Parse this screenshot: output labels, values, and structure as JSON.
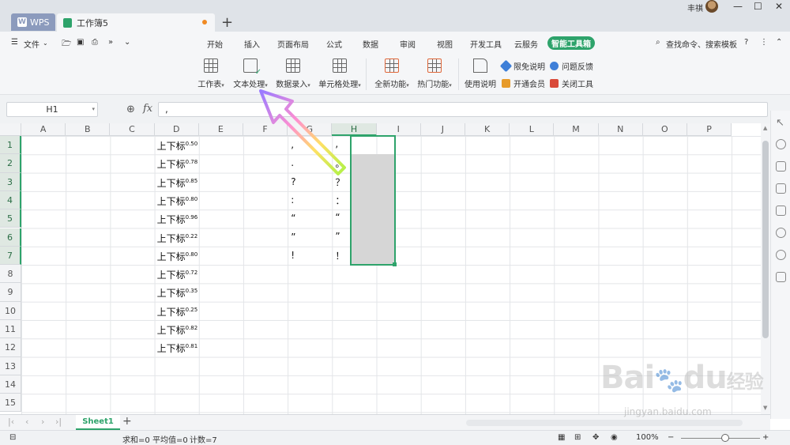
{
  "titlebar": {
    "tabs": [
      {
        "label": "WPS"
      },
      {
        "label": "工作簿5"
      }
    ],
    "user_name": "丰祺"
  },
  "menubar": {
    "file": "文件",
    "items": [
      "开始",
      "插入",
      "页面布局",
      "公式",
      "数据",
      "审阅",
      "视图",
      "开发工具",
      "云服务"
    ],
    "active": "智能工具箱",
    "search": "查找命令、搜索模板"
  },
  "ribbon": {
    "groups": [
      {
        "label": "工作表"
      },
      {
        "label": "文本处理"
      },
      {
        "label": "数据录入"
      },
      {
        "label": "单元格处理"
      },
      {
        "label": "全新功能"
      },
      {
        "label": "热门功能"
      },
      {
        "label": "使用说明"
      }
    ],
    "side": [
      {
        "label": "限免说明"
      },
      {
        "label": "问题反馈"
      },
      {
        "label": "开通会员"
      },
      {
        "label": "关闭工具"
      }
    ]
  },
  "formula": {
    "name_box": "H1",
    "fx": "fx",
    "value": ","
  },
  "grid": {
    "columns": [
      "A",
      "B",
      "C",
      "D",
      "E",
      "F",
      "G",
      "H",
      "I",
      "J",
      "K",
      "L",
      "M",
      "N",
      "O",
      "P"
    ],
    "rows": [
      "1",
      "2",
      "3",
      "4",
      "5",
      "6",
      "7",
      "8",
      "9",
      "10",
      "11",
      "12",
      "13",
      "14",
      "15"
    ],
    "selected_column": "H",
    "col_d": [
      {
        "text": "上下标",
        "sup": "0.50"
      },
      {
        "text": "上下标",
        "sup": "0.78"
      },
      {
        "text": "上下标",
        "sup": "0.85"
      },
      {
        "text": "上下标",
        "sup": "0.80"
      },
      {
        "text": "上下标",
        "sup": "0.96"
      },
      {
        "text": "上下标",
        "sup": "0.22"
      },
      {
        "text": "上下标",
        "sup": "0.80"
      },
      {
        "text": "上下标",
        "sup": "0.72"
      },
      {
        "text": "上下标",
        "sup": "0.35"
      },
      {
        "text": "上下标",
        "sup": "0.25"
      },
      {
        "text": "上下标",
        "sup": "0.82"
      },
      {
        "text": "上下标",
        "sup": "0.81"
      }
    ],
    "col_g": [
      ",",
      ".",
      "?",
      ":",
      "“",
      "”",
      "!"
    ],
    "col_h": [
      ",",
      "。",
      "？",
      "：",
      "“",
      "”",
      "！"
    ]
  },
  "sheets": {
    "tabs": [
      "Sheet1"
    ],
    "add": "+"
  },
  "status": {
    "sum": "求和=0",
    "avg": "平均值=0",
    "count": "计数=7",
    "zoom": "100%",
    "minus": "−",
    "plus": "+"
  },
  "watermark": {
    "text": "Bai",
    "text2": "du",
    "suffix": "经验",
    "url": "jingyan.baidu.com"
  }
}
